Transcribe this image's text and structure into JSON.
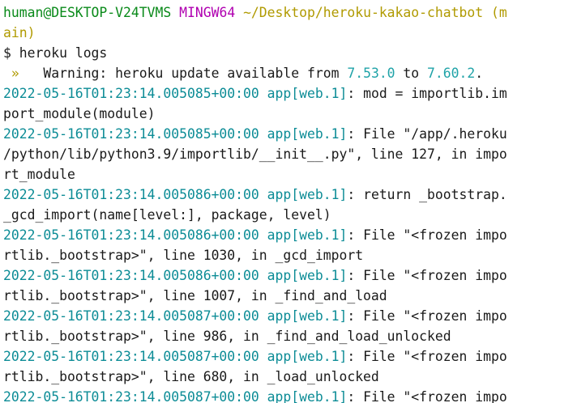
{
  "prompt": {
    "user_host": "human@DESKTOP-V24TVMS",
    "shell": "MINGW64",
    "path_part1": "~/Desktop/heroku-kakao-chatbot (m",
    "path_part2": "ain)",
    "symbol": "$",
    "command": "heroku logs"
  },
  "warning": {
    "arrow": " »",
    "text_before": "   Warning: heroku update available from ",
    "from_version": "7.53.0",
    "text_mid": " to ",
    "to_version": "7.60.2",
    "text_after": "."
  },
  "log_rows": [
    {
      "type": "entry",
      "ts": "2022-05-16T01:23:14.005085+00:00",
      "src": "app[web.1]",
      "msg": ": mod = importlib.im"
    },
    {
      "type": "cont",
      "msg": "port_module(module)"
    },
    {
      "type": "entry",
      "ts": "2022-05-16T01:23:14.005085+00:00",
      "src": "app[web.1]",
      "msg": ": File \"/app/.heroku"
    },
    {
      "type": "cont",
      "msg": "/python/lib/python3.9/importlib/__init__.py\", line 127, in impo"
    },
    {
      "type": "cont",
      "msg": "rt_module"
    },
    {
      "type": "entry",
      "ts": "2022-05-16T01:23:14.005086+00:00",
      "src": "app[web.1]",
      "msg": ": return _bootstrap."
    },
    {
      "type": "cont",
      "msg": "_gcd_import(name[level:], package, level)"
    },
    {
      "type": "entry",
      "ts": "2022-05-16T01:23:14.005086+00:00",
      "src": "app[web.1]",
      "msg": ": File \"<frozen impo"
    },
    {
      "type": "cont",
      "msg": "rtlib._bootstrap>\", line 1030, in _gcd_import"
    },
    {
      "type": "entry",
      "ts": "2022-05-16T01:23:14.005086+00:00",
      "src": "app[web.1]",
      "msg": ": File \"<frozen impo"
    },
    {
      "type": "cont",
      "msg": "rtlib._bootstrap>\", line 1007, in _find_and_load"
    },
    {
      "type": "entry",
      "ts": "2022-05-16T01:23:14.005087+00:00",
      "src": "app[web.1]",
      "msg": ": File \"<frozen impo"
    },
    {
      "type": "cont",
      "msg": "rtlib._bootstrap>\", line 986, in _find_and_load_unlocked"
    },
    {
      "type": "entry",
      "ts": "2022-05-16T01:23:14.005087+00:00",
      "src": "app[web.1]",
      "msg": ": File \"<frozen impo"
    },
    {
      "type": "cont",
      "msg": "rtlib._bootstrap>\", line 680, in _load_unlocked"
    },
    {
      "type": "entry",
      "ts": "2022-05-16T01:23:14.005087+00:00",
      "src": "app[web.1]",
      "msg": ": File \"<frozen impo"
    }
  ],
  "colors": {
    "background": "#ffffff",
    "text": "#1a1a1a",
    "prompt_user": "#0a8a1a",
    "prompt_shell": "#b000b0",
    "prompt_path": "#b09a00",
    "timestamp": "#0c8c96",
    "version": "#20a3a8"
  }
}
